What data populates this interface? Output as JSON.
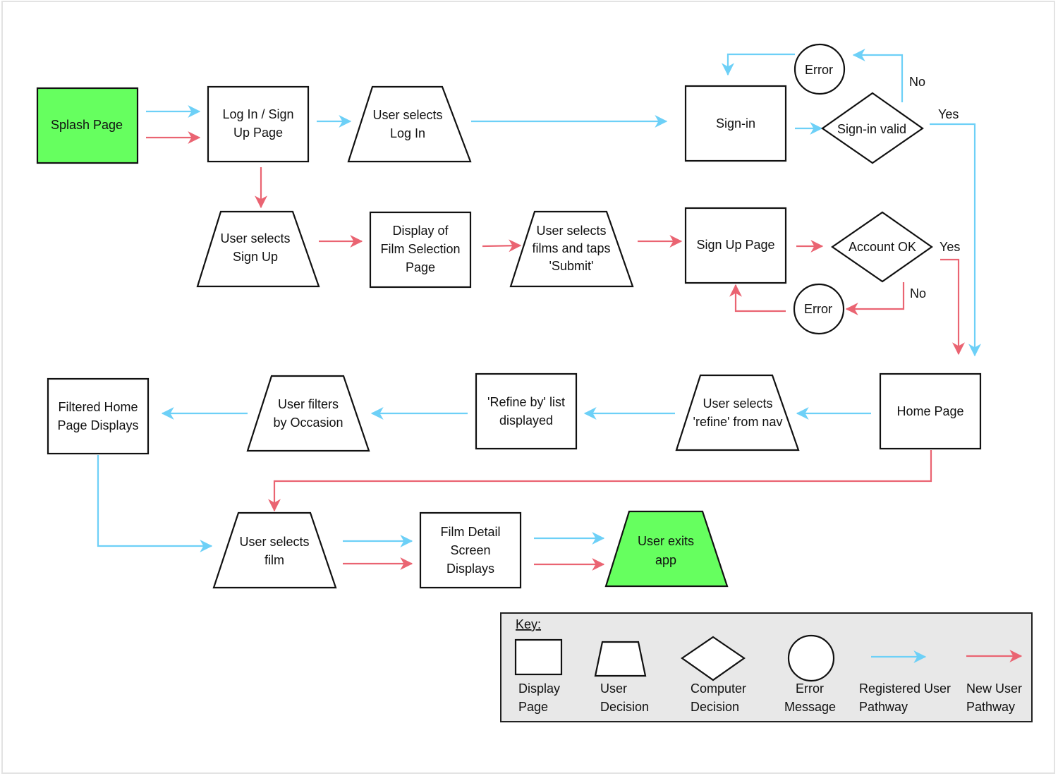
{
  "colors": {
    "registered_pathway": "#6dd0f7",
    "new_user_pathway": "#ea6472",
    "terminal_fill": "#66ff5f",
    "key_background": "#e8e8e8"
  },
  "nodes": {
    "splash_page": {
      "type": "display-page",
      "lines": [
        "Splash Page"
      ]
    },
    "login_signup_page": {
      "type": "display-page",
      "lines": [
        "Log In / Sign",
        "Up Page"
      ]
    },
    "user_selects_login": {
      "type": "user-decision",
      "lines": [
        "User selects",
        "Log In"
      ]
    },
    "sign_in": {
      "type": "display-page",
      "lines": [
        "Sign-in"
      ]
    },
    "sign_in_valid": {
      "type": "computer-decision",
      "lines": [
        "Sign-in valid"
      ]
    },
    "error_top": {
      "type": "error-message",
      "lines": [
        "Error"
      ]
    },
    "user_selects_signup": {
      "type": "user-decision",
      "lines": [
        "User selects",
        "Sign Up"
      ]
    },
    "film_selection_page": {
      "type": "display-page",
      "lines": [
        "Display of",
        "Film Selection",
        "Page"
      ]
    },
    "user_selects_films": {
      "type": "user-decision",
      "lines": [
        "User selects",
        "films and taps",
        "'Submit'"
      ]
    },
    "sign_up_page": {
      "type": "display-page",
      "lines": [
        "Sign Up Page"
      ]
    },
    "account_ok": {
      "type": "computer-decision",
      "lines": [
        "Account OK"
      ]
    },
    "error_bottom": {
      "type": "error-message",
      "lines": [
        "Error"
      ]
    },
    "home_page": {
      "type": "display-page",
      "lines": [
        "Home Page"
      ]
    },
    "user_selects_refine": {
      "type": "user-decision",
      "lines": [
        "User selects",
        "'refine' from nav"
      ]
    },
    "refine_list": {
      "type": "display-page",
      "lines": [
        "'Refine by' list",
        "displayed"
      ]
    },
    "user_filters_occasion": {
      "type": "user-decision",
      "lines": [
        "User filters",
        "by Occasion"
      ]
    },
    "filtered_home": {
      "type": "display-page",
      "lines": [
        "Filtered Home",
        "Page Displays"
      ]
    },
    "user_selects_film": {
      "type": "user-decision",
      "lines": [
        "User selects",
        "film"
      ]
    },
    "film_detail": {
      "type": "display-page",
      "lines": [
        "Film Detail",
        "Screen",
        "Displays"
      ]
    },
    "user_exits": {
      "type": "user-decision",
      "lines": [
        "User exits",
        "app"
      ]
    }
  },
  "edge_labels": {
    "sign_in_no": "No",
    "sign_in_yes": "Yes",
    "account_yes": "Yes",
    "account_no": "No"
  },
  "key": {
    "title": "Key:",
    "items": [
      {
        "lines": [
          "Display",
          "Page"
        ]
      },
      {
        "lines": [
          "User",
          "Decision"
        ]
      },
      {
        "lines": [
          "Computer",
          "Decision"
        ]
      },
      {
        "lines": [
          "Error",
          "Message"
        ]
      },
      {
        "lines": [
          "Registered User",
          "Pathway"
        ]
      },
      {
        "lines": [
          "New User",
          "Pathway"
        ]
      }
    ]
  }
}
